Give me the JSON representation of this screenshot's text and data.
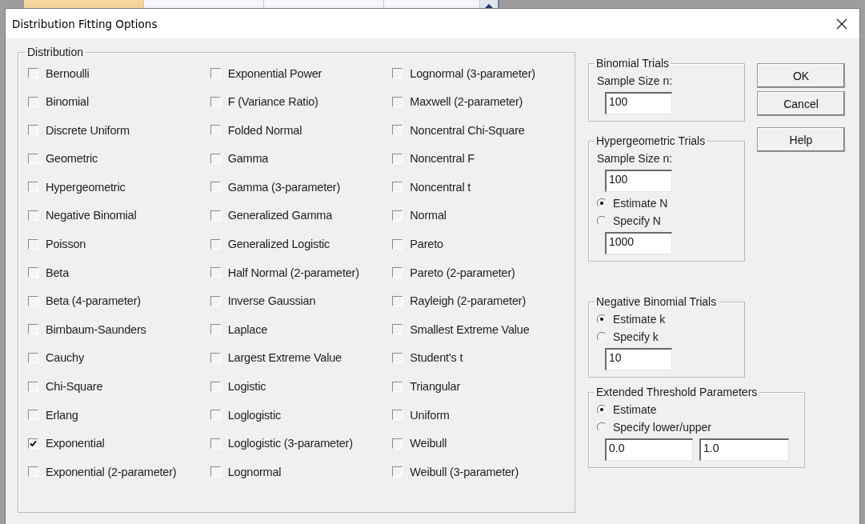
{
  "window": {
    "title": "Distribution Fitting Options"
  },
  "distribution": {
    "title": "Distribution",
    "columns": [
      [
        {
          "label": "Bernoulli",
          "checked": false
        },
        {
          "label": "Binomial",
          "checked": false
        },
        {
          "label": "Discrete Uniform",
          "checked": false
        },
        {
          "label": "Geometric",
          "checked": false
        },
        {
          "label": "Hypergeometric",
          "checked": false
        },
        {
          "label": "Negative Binomial",
          "checked": false
        },
        {
          "label": "Poisson",
          "checked": false
        },
        {
          "label": "Beta",
          "checked": false
        },
        {
          "label": "Beta (4-parameter)",
          "checked": false
        },
        {
          "label": "Birnbaum-Saunders",
          "checked": false
        },
        {
          "label": "Cauchy",
          "checked": false
        },
        {
          "label": "Chi-Square",
          "checked": false
        },
        {
          "label": "Erlang",
          "checked": false
        },
        {
          "label": "Exponential",
          "checked": true
        },
        {
          "label": "Exponential (2-parameter)",
          "checked": false
        }
      ],
      [
        {
          "label": "Exponential Power",
          "checked": false
        },
        {
          "label": "F (Variance Ratio)",
          "checked": false
        },
        {
          "label": "Folded Normal",
          "checked": false
        },
        {
          "label": "Gamma",
          "checked": false
        },
        {
          "label": "Gamma (3-parameter)",
          "checked": false
        },
        {
          "label": "Generalized Gamma",
          "checked": false
        },
        {
          "label": "Generalized Logistic",
          "checked": false
        },
        {
          "label": "Half Normal (2-parameter)",
          "checked": false
        },
        {
          "label": "Inverse Gaussian",
          "checked": false
        },
        {
          "label": "Laplace",
          "checked": false
        },
        {
          "label": "Largest Extreme Value",
          "checked": false
        },
        {
          "label": "Logistic",
          "checked": false
        },
        {
          "label": "Loglogistic",
          "checked": false
        },
        {
          "label": "Loglogistic (3-parameter)",
          "checked": false
        },
        {
          "label": "Lognormal",
          "checked": false
        }
      ],
      [
        {
          "label": "Lognormal (3-parameter)",
          "checked": false
        },
        {
          "label": "Maxwell (2-parameter)",
          "checked": false
        },
        {
          "label": "Noncentral Chi-Square",
          "checked": false
        },
        {
          "label": "Noncentral F",
          "checked": false
        },
        {
          "label": "Noncentral t",
          "checked": false
        },
        {
          "label": "Normal",
          "checked": false
        },
        {
          "label": "Pareto",
          "checked": false
        },
        {
          "label": "Pareto (2-parameter)",
          "checked": false
        },
        {
          "label": "Rayleigh (2-parameter)",
          "checked": false
        },
        {
          "label": "Smallest Extreme Value",
          "checked": false
        },
        {
          "label": "Student's t",
          "checked": false
        },
        {
          "label": "Triangular",
          "checked": false
        },
        {
          "label": "Uniform",
          "checked": false
        },
        {
          "label": "Weibull",
          "checked": false
        },
        {
          "label": "Weibull (3-parameter)",
          "checked": false
        }
      ]
    ]
  },
  "binomial_trials": {
    "title": "Binomial Trials",
    "items": [
      {
        "kind": "label",
        "text": "Sample Size n:"
      },
      {
        "kind": "field",
        "value": "100"
      }
    ]
  },
  "hypergeometric_trials": {
    "title": "Hypergeometric Trials",
    "items": [
      {
        "kind": "label",
        "text": "Sample Size n:"
      },
      {
        "kind": "field",
        "value": "100"
      },
      {
        "kind": "radio",
        "label": "Estimate N",
        "selected": true
      },
      {
        "kind": "radio",
        "label": "Specify N",
        "selected": false
      },
      {
        "kind": "field",
        "value": "1000"
      }
    ]
  },
  "negative_binomial_trials": {
    "title": "Negative Binomial Trials",
    "items": [
      {
        "kind": "radio",
        "label": "Estimate k",
        "selected": true
      },
      {
        "kind": "radio",
        "label": "Specify k",
        "selected": false
      },
      {
        "kind": "field",
        "value": "10"
      }
    ]
  },
  "extended_threshold_parameters": {
    "title": "Extended Threshold Parameters",
    "items": [
      {
        "kind": "radio",
        "label": "Estimate",
        "selected": true
      },
      {
        "kind": "radio",
        "label": "Specify lower/upper",
        "selected": false
      },
      {
        "kind": "fields",
        "values": [
          "0.0",
          "1.0"
        ]
      }
    ]
  },
  "buttons": [
    "OK",
    "Cancel",
    "Help"
  ]
}
